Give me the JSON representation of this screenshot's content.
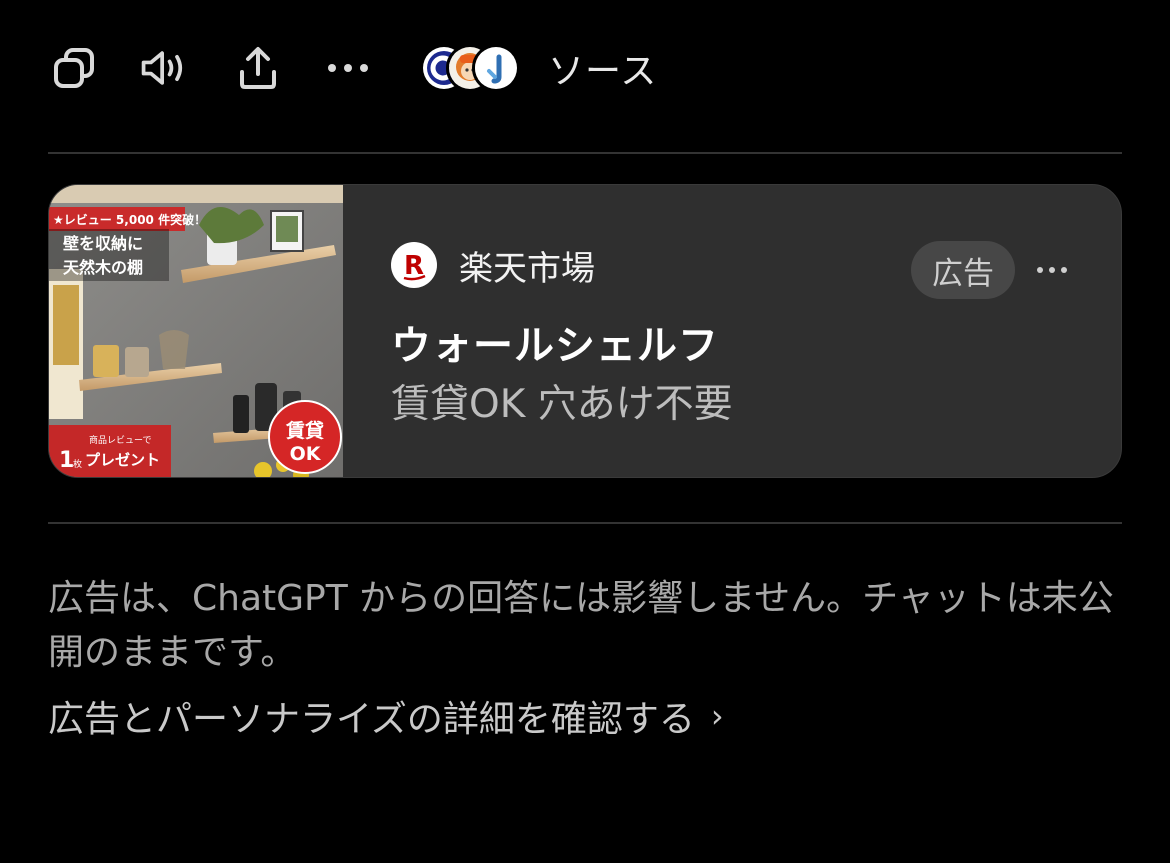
{
  "toolbar": {
    "icons": [
      "copy-icon",
      "speaker-icon",
      "share-icon",
      "more-icon"
    ],
    "sources_label": "ソース"
  },
  "ad": {
    "image_text": {
      "review_badge": "★レビュー 5,000 件突破！",
      "headline_line1": "壁を収納に",
      "headline_line2": "天然木の棚",
      "present_small": "商品レビューで",
      "present_num": "1",
      "present_unit": "枚",
      "present_label": "プレゼント",
      "seal_line1": "賃貸",
      "seal_line2": "OK"
    },
    "brand": "楽天市場",
    "brand_logo_letter": "R",
    "badge": "広告",
    "title": "ウォールシェルフ",
    "subtitle": "賃貸OK 穴あけ不要"
  },
  "footer": {
    "disclaimer": "広告は、ChatGPT からの回答には影響しません。チャットは未公開のままです。",
    "details_link": "広告とパーソナライズの詳細を確認する",
    "chevron": "›"
  },
  "colors": {
    "background": "#000000",
    "card": "#2f2f2f",
    "rakuten_red": "#bf0000",
    "muted_text": "#a8a8a8"
  }
}
